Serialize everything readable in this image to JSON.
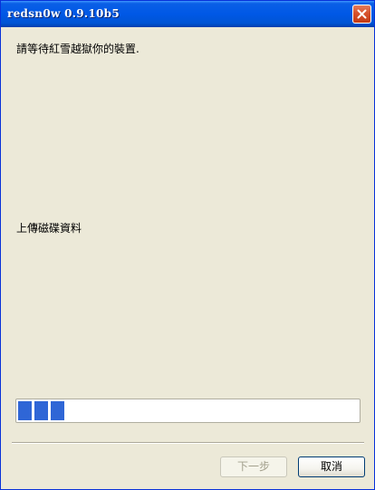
{
  "window": {
    "title": "redsn0w 0.9.10b5"
  },
  "content": {
    "wait_message": "請等待紅雪越獄你的裝置.",
    "status_message": "上傳磁碟資料",
    "progress_fraction": 0.14
  },
  "buttons": {
    "next_label": "下一步",
    "cancel_label": "取消"
  },
  "colors": {
    "progress_block": "#2f66d6",
    "title_bar": "#0058e6",
    "face": "#ece9d8"
  }
}
